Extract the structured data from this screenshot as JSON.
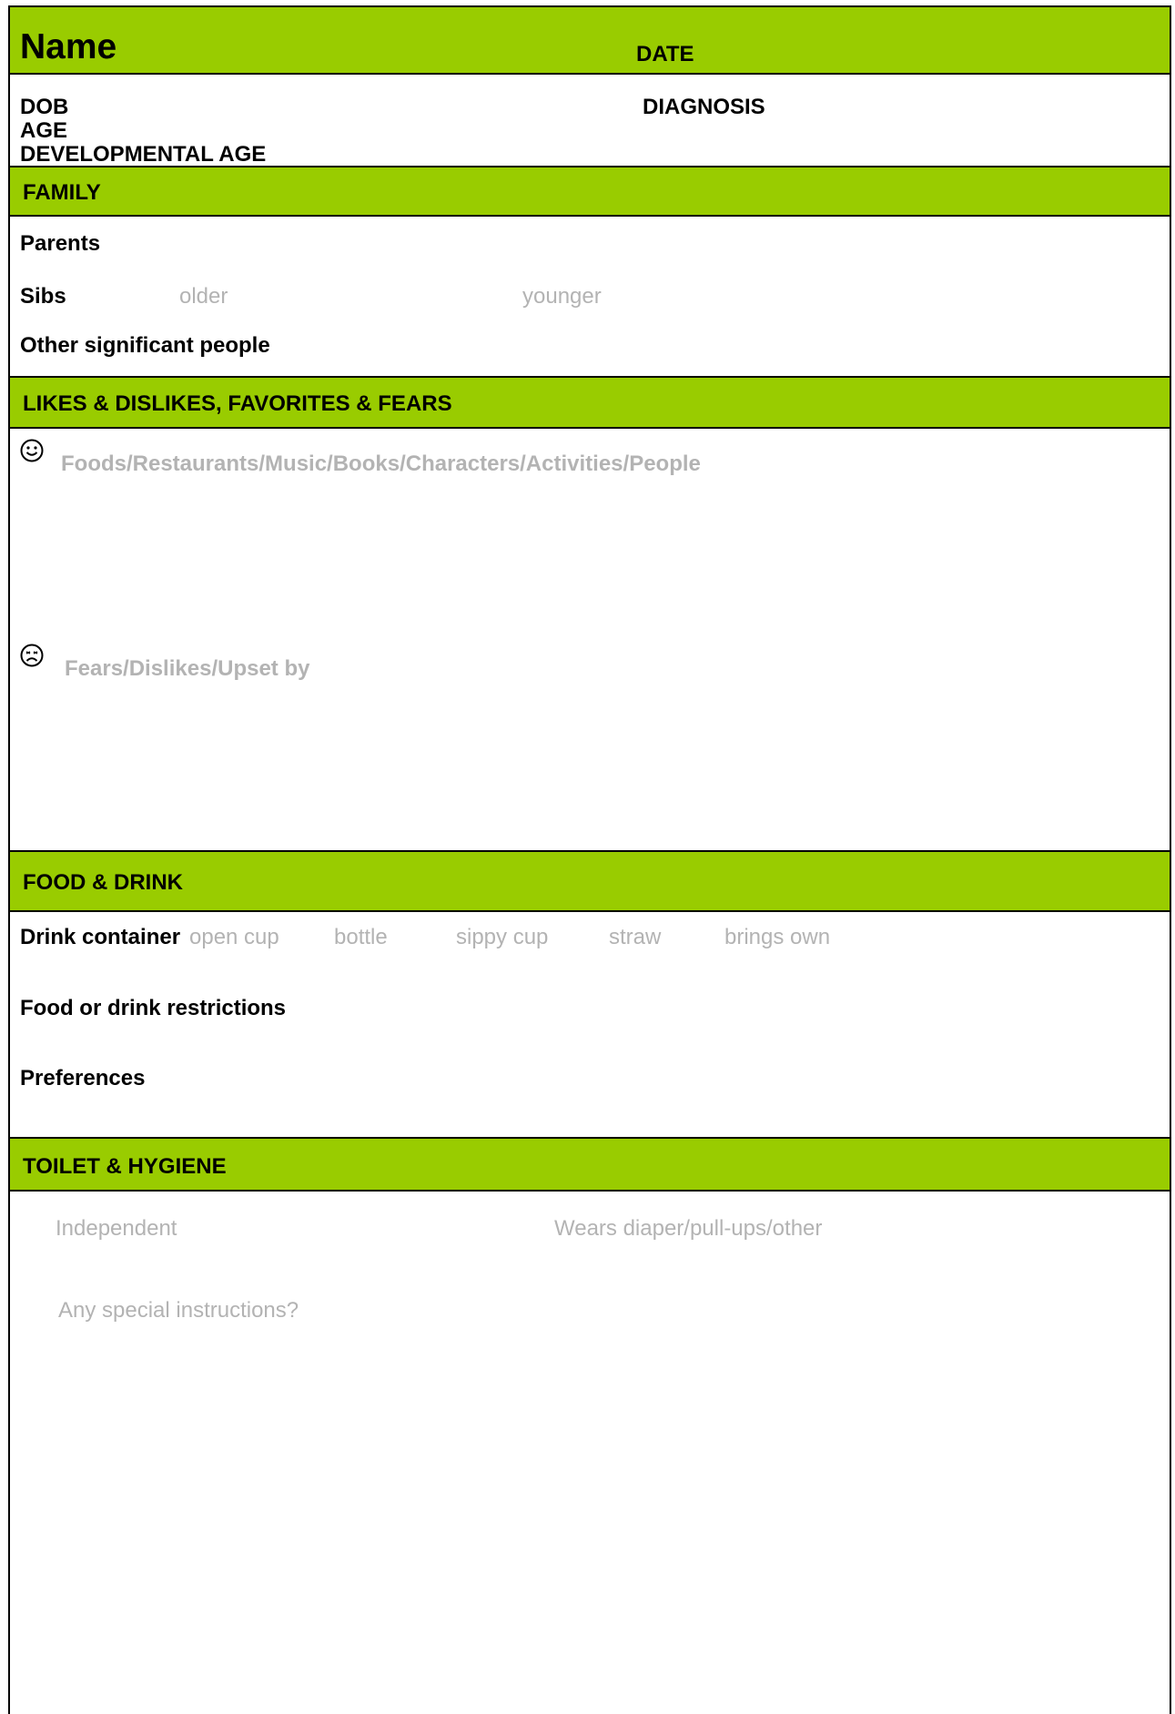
{
  "header": {
    "name_label": "Name",
    "date_label": "DATE",
    "dob_label": "DOB",
    "age_label": "AGE",
    "dev_age_label": "DEVELOPMENTAL AGE",
    "diagnosis_label": "DIAGNOSIS"
  },
  "family": {
    "title": "FAMILY",
    "parents_label": "Parents",
    "sibs_label": "Sibs",
    "sibs_older": "older",
    "sibs_younger": "younger",
    "other_label": "Other significant people"
  },
  "likes": {
    "title": "LIKES & DISLIKES, FAVORITES & FEARS",
    "likes_prompt": "Foods/Restaurants/Music/Books/Characters/Activities/People",
    "dislikes_prompt": "Fears/Dislikes/Upset by",
    "happy_icon": "smiley-face-icon",
    "sad_icon": "frowning-face-icon"
  },
  "food": {
    "title": "FOOD & DRINK",
    "drink_label": "Drink container",
    "drink_options": [
      "open cup",
      "bottle",
      "sippy cup",
      "straw",
      "brings own"
    ],
    "restrictions_label": "Food or drink restrictions",
    "preferences_label": "Preferences"
  },
  "toilet": {
    "title": "TOILET & HYGIENE",
    "independent": "Independent",
    "diaper": "Wears diaper/pull-ups/other",
    "special": "Any special instructions?"
  },
  "colors": {
    "accent": "#99cc00",
    "hint_text": "#b3b3b3"
  }
}
